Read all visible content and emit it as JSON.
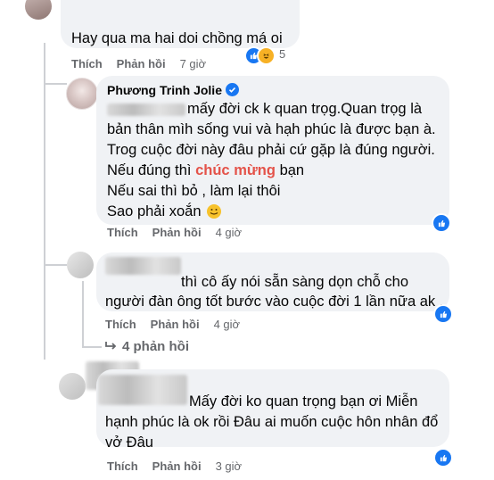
{
  "comment1": {
    "text": "Hay qua ma hai doi chồng má oi",
    "like_label": "Thích",
    "reply_label": "Phản hồi",
    "time": "7 giờ",
    "reaction_count": "5"
  },
  "reply1": {
    "author": "Phương Trinh Jolie",
    "line1_tail": "mấy đời ck k quan trọg.Quan trọg là",
    "line2": "bản thân mìh sống vui và hạh phúc là được bạn à.",
    "line3": "Trog cuộc đời này đâu phải cứ gặp là đúng người.",
    "line4_pre": "Nếu đúng thì",
    "line4_highlight": "chúc mừng",
    "line4_post": "bạn",
    "line5": "Nếu sai thì bỏ , làm lại thôi",
    "line6": "Sao phải xoắn",
    "like_label": "Thích",
    "reply_label": "Phản hồi",
    "time": "4 giờ"
  },
  "reply2": {
    "line1_tail": "thì cô ấy nói sẵn sàng dọn chỗ cho",
    "line2": "người đàn ông tốt bước vào cuộc đời 1 lần nữa ak .",
    "like_label": "Thích",
    "reply_label": "Phản hồi",
    "time": "4 giờ",
    "more_replies": "4 phản hồi"
  },
  "comment2": {
    "line1_tail": "Mấy đời ko quan trọng bạn ơi Miễn",
    "line2": "hạnh phúc là ok rồi Đâu ai muốn cuộc hôn nhân đổ",
    "line3": "vở Đâu",
    "like_label": "Thích",
    "reply_label": "Phản hồi",
    "time": "3 giờ"
  },
  "colors": {
    "bubble": "#f0f2f5",
    "meta": "#65676b",
    "accent": "#1877f2",
    "highlight": "#e4534a"
  }
}
